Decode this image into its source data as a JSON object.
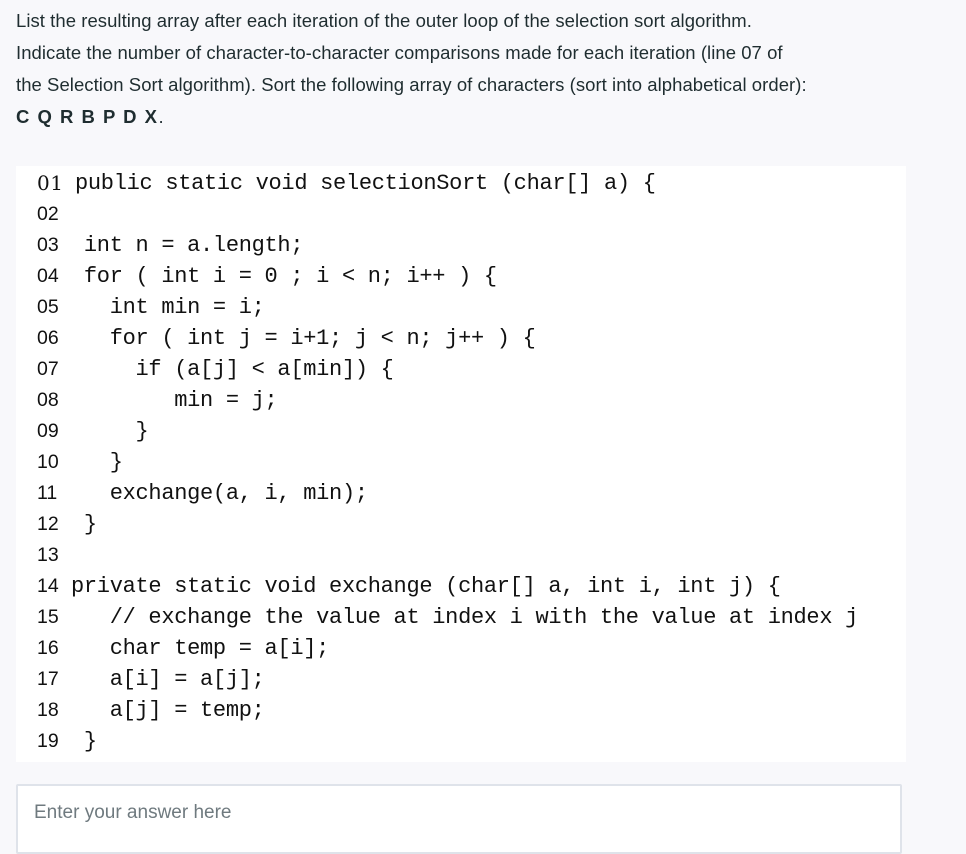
{
  "question": {
    "lines": [
      "List the resulting array after each iteration of the outer loop of the selection sort algorithm.",
      "Indicate the number of character-to-character comparisons made for each iteration (line 07 of",
      "the Selection Sort algorithm). Sort the following array of characters (sort into alphabetical order):"
    ],
    "characters": "C Q R B P D X",
    "characters_suffix": "."
  },
  "code": {
    "lines": [
      {
        "num": "01",
        "text": "public static void selectionSort (char[] a) {"
      },
      {
        "num": "02",
        "text": ""
      },
      {
        "num": "03",
        "text": " int n = a.length;"
      },
      {
        "num": "04",
        "text": " for ( int i = 0 ; i < n; i++ ) {"
      },
      {
        "num": "05",
        "text": "   int min = i;"
      },
      {
        "num": "06",
        "text": "   for ( int j = i+1; j < n; j++ ) {"
      },
      {
        "num": "07",
        "text": "     if (a[j] < a[min]) {"
      },
      {
        "num": "08",
        "text": "        min = j;"
      },
      {
        "num": "09",
        "text": "     }"
      },
      {
        "num": "10",
        "text": "   }"
      },
      {
        "num": "11",
        "text": "   exchange(a, i, min);"
      },
      {
        "num": "12",
        "text": " }"
      },
      {
        "num": "13",
        "text": ""
      },
      {
        "num": "14",
        "text": "private static void exchange (char[] a, int i, int j) {"
      },
      {
        "num": "15",
        "text": "   // exchange the value at index i with the value at index j"
      },
      {
        "num": "16",
        "text": "   char temp = a[i];"
      },
      {
        "num": "17",
        "text": "   a[i] = a[j];"
      },
      {
        "num": "18",
        "text": "   a[j] = temp;"
      },
      {
        "num": "19",
        "text": " }"
      }
    ]
  },
  "answer": {
    "value": "",
    "placeholder": "Enter your answer here"
  }
}
